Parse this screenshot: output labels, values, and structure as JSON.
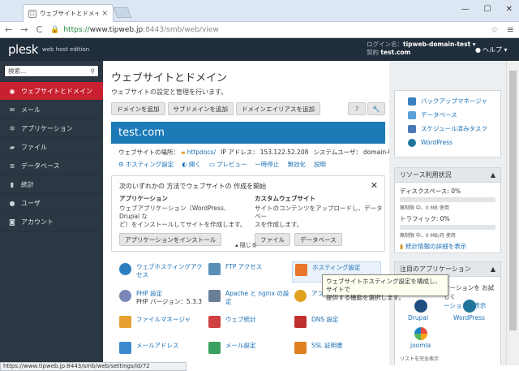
{
  "browser": {
    "tab_title": "ウェブサイトとドメイン - Plesk",
    "url_scheme": "https://",
    "url_host": "www.tipweb.jp",
    "url_path": ":8443/smb/web/view",
    "status_url": "https://www.tipweb.jp:8443/smb/web/settings/id/72"
  },
  "header": {
    "logo": "plesk",
    "edition": "web host edition",
    "login_label": "ログイン名：",
    "login_value": "tipweb-domain-test ▾",
    "contract_label": "契約",
    "contract_value": "test.com",
    "help": "ヘルプ ▾"
  },
  "sidebar": {
    "search_placeholder": "検索...",
    "items": [
      {
        "label": "ウェブサイトとドメイン",
        "icon": "globe-icon"
      },
      {
        "label": "メール",
        "icon": "mail-icon"
      },
      {
        "label": "アプリケーション",
        "icon": "gear-icon"
      },
      {
        "label": "ファイル",
        "icon": "folder-icon"
      },
      {
        "label": "データベース",
        "icon": "database-icon"
      },
      {
        "label": "統計",
        "icon": "chart-icon"
      },
      {
        "label": "ユーザ",
        "icon": "user-icon"
      },
      {
        "label": "アカウント",
        "icon": "account-icon"
      }
    ]
  },
  "main": {
    "title": "ウェブサイトとドメイン",
    "subtitle": "ウェブサイトの設定と管理を行います。",
    "buttons": [
      "ドメインを追加",
      "サブドメインを追加",
      "ドメインエイリアスを追加"
    ],
    "help_btn": "?",
    "domain": {
      "name": "test.com",
      "location_label": "ウェブサイトの場所：",
      "location_value": "httpdocs/",
      "ip_label": "IP アドレス：",
      "ip_value": "153.122.52.208",
      "sysuser_label": "システムユーザ：",
      "sysuser_value": "domain-test",
      "actions": [
        "ホスティング設定",
        "開く",
        "プレビュー",
        "一時停止",
        "無効化",
        "説明"
      ]
    },
    "panel": {
      "title": "次のいずれかの 方法でウェブサイトの 作成を開始",
      "app_title": "アプリケーション",
      "app_text1": "ウェブアプリケーション（WordPress、Drupal な",
      "app_text2": "ど）をインストールしてサイトを作成します。",
      "app_button": "アプリケーションをインストール",
      "custom_title": "カスタムウェブサイト",
      "custom_text1": "サイトのコンテンツをアップロードし、データベー",
      "custom_text2": "スを作成します。",
      "file_button": "ファイル",
      "db_button": "データベース"
    },
    "collapse": "▴ 隠じる",
    "tiles": [
      {
        "label": "ウェブホスティングアク",
        "label2": "セス",
        "icon": "hosting-access-icon",
        "color": "#2d7fc1"
      },
      {
        "label": "FTP アクセス",
        "label2": "",
        "icon": "ftp-icon",
        "color": "#5a8fb8"
      },
      {
        "label": "ホスティング設定",
        "label2": "",
        "icon": "hosting-settings-icon",
        "color": "#e8752a"
      },
      {
        "label": "PHP 設定",
        "label2": "",
        "sub": "PHP バージョン：5.3.3",
        "icon": "php-icon",
        "color": "#7a86b8"
      },
      {
        "label": "Apache と nginx の設",
        "label2": "定",
        "icon": "apache-icon",
        "color": "#6a7f95"
      },
      {
        "label": "アプリケーション",
        "label2": "",
        "icon": "applications-icon",
        "color": "#e0a020"
      },
      {
        "label": "ファイルマネージャ",
        "label2": "",
        "icon": "file-manager-icon",
        "color": "#e8a030"
      },
      {
        "label": "ウェブ統計",
        "label2": "",
        "icon": "web-stats-icon",
        "color": "#d04040"
      },
      {
        "label": "DNS 設定",
        "label2": "",
        "icon": "dns-icon",
        "color": "#c03030"
      },
      {
        "label": "メールアドレス",
        "label2": "",
        "icon": "email-icon",
        "color": "#3a8ad0"
      },
      {
        "label": "メール設定",
        "label2": "",
        "icon": "mail-settings-icon",
        "color": "#3aa060"
      },
      {
        "label": "SSL 証明書",
        "label2": "",
        "icon": "ssl-icon",
        "color": "#e08020"
      }
    ],
    "tooltip1": "ウェブサイトホスティング設定を構成し、サイトで",
    "tooltip2": "提供する機能を選択します。"
  },
  "right": {
    "links": [
      {
        "label": "バックアップマネージャ",
        "icon": "backup-icon",
        "color": "#3a7fc0"
      },
      {
        "label": "データベース",
        "icon": "database-icon",
        "color": "#5aa0d8"
      },
      {
        "label": "スケジュール済みタスク",
        "icon": "schedule-icon",
        "color": "#4a7ab8"
      },
      {
        "label": "WordPress",
        "icon": "wordpress-icon",
        "color": "#21759b"
      }
    ],
    "resources": {
      "title": "リソース利用状況",
      "disk_label": "ディスクスペース: 0%",
      "disk_small": "無制限 中、0 MB 使用",
      "traffic_label": "トラフィック: 0%",
      "traffic_small": "無制限 中、0 MB/月 使用",
      "stats_link": "統計情報の詳細を表示"
    },
    "featured": {
      "title": "注目のアプリケーション",
      "line1": "ケーションを お試しく",
      "line2": "ーションを表示",
      "apps": [
        "Drupal",
        "WordPress",
        "joomla"
      ],
      "footer": "リストを完全表示"
    }
  }
}
